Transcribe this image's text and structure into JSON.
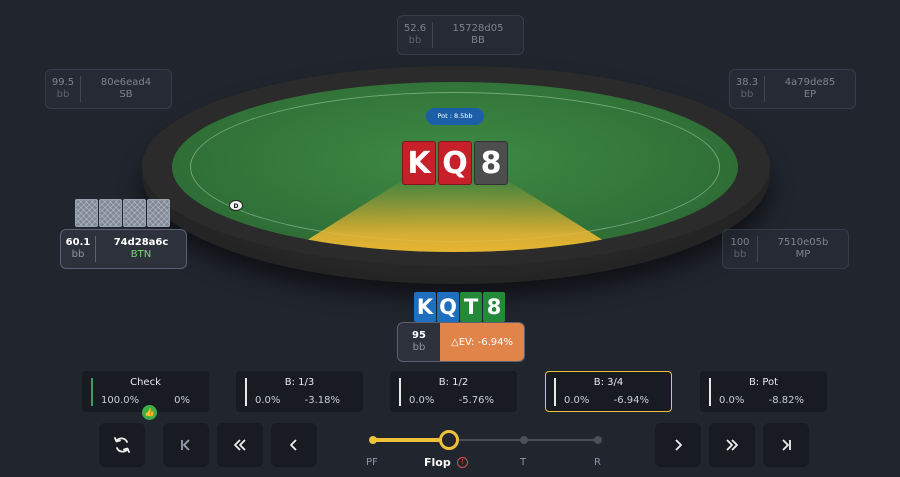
{
  "pot": {
    "label": "Pot : 8.5bb"
  },
  "board": [
    {
      "rank": "K",
      "suit_color": "red"
    },
    {
      "rank": "Q",
      "suit_color": "red"
    },
    {
      "rank": "8",
      "suit_color": "gray"
    }
  ],
  "dealer_button": {
    "label": "D"
  },
  "seats": [
    {
      "id": "BB",
      "stack": "52.6",
      "unit": "bb",
      "player": "15728d05",
      "position": "BB",
      "active": false
    },
    {
      "id": "SB",
      "stack": "99.5",
      "unit": "bb",
      "player": "80e6ead4",
      "position": "SB",
      "active": false
    },
    {
      "id": "EP",
      "stack": "38.3",
      "unit": "bb",
      "player": "4a79de85",
      "position": "EP",
      "active": false
    },
    {
      "id": "BTN",
      "stack": "60.1",
      "unit": "bb",
      "player": "74d28a6c",
      "position": "BTN",
      "active": true
    },
    {
      "id": "MP",
      "stack": "100",
      "unit": "bb",
      "player": "7510e05b",
      "position": "MP",
      "active": false
    }
  ],
  "hero": {
    "cards": [
      {
        "rank": "K",
        "color": "blue"
      },
      {
        "rank": "Q",
        "color": "blue"
      },
      {
        "rank": "T",
        "color": "green"
      },
      {
        "rank": "8",
        "color": "green"
      }
    ],
    "stack": "95",
    "unit": "bb",
    "ev_label": "△EV: -6.94%"
  },
  "actions": [
    {
      "label": "Check",
      "freq": "100.0%",
      "ev": "0%",
      "selected": false
    },
    {
      "label": "B: 1/3",
      "freq": "0.0%",
      "ev": "-3.18%",
      "selected": false
    },
    {
      "label": "B: 1/2",
      "freq": "0.0%",
      "ev": "-5.76%",
      "selected": false
    },
    {
      "label": "B: 3/4",
      "freq": "0.0%",
      "ev": "-6.94%",
      "selected": true
    },
    {
      "label": "B: Pot",
      "freq": "0.0%",
      "ev": "-8.82%",
      "selected": false
    }
  ],
  "nav": {
    "reset_icon": "refresh-icon",
    "first_icon": "skip-back-icon",
    "back_fast_icon": "double-chevron-left-icon",
    "back_icon": "chevron-left-icon",
    "forward_icon": "chevron-right-icon",
    "forward_fast_icon": "double-chevron-right-icon",
    "last_icon": "skip-forward-icon"
  },
  "streets": [
    {
      "label": "PF",
      "state": "done"
    },
    {
      "label": "Flop",
      "state": "current"
    },
    {
      "label": "T",
      "state": "pending"
    },
    {
      "label": "R",
      "state": "pending"
    }
  ],
  "colors": {
    "accent": "#f0c23a",
    "felt": "#2f6f36",
    "ev_negative": "#e0844a",
    "card_red": "#c8202a",
    "card_blue": "#1f6fc0",
    "card_green": "#238a3a"
  }
}
